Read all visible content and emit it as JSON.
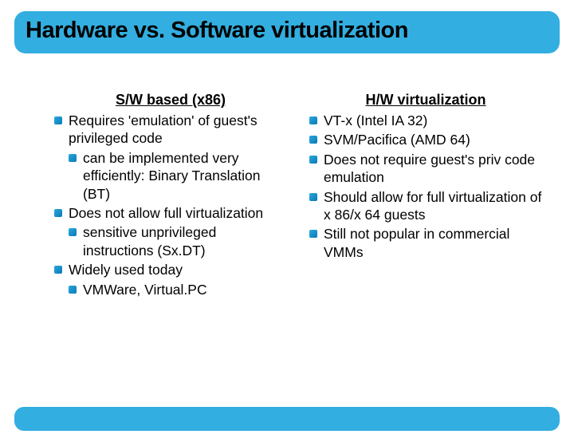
{
  "title": "Hardware vs. Software virtualization",
  "left": {
    "heading": "S/W based (x86)",
    "items": [
      {
        "text": "Requires 'emulation' of guest's privileged code",
        "sub": [
          {
            "text": "can be implemented very efficiently: Binary Translation (BT)"
          }
        ]
      },
      {
        "text": "Does not allow full virtualization",
        "sub": [
          {
            "text": "sensitive unprivileged instructions (Sx.DT)"
          }
        ]
      },
      {
        "text": "Widely used today",
        "sub": [
          {
            "text": "VMWare, Virtual.PC"
          }
        ]
      }
    ]
  },
  "right": {
    "heading": "H/W virtualization",
    "items": [
      {
        "text": "VT-x (Intel IA 32)"
      },
      {
        "text": "SVM/Pacifica (AMD 64)"
      },
      {
        "text": "Does not require guest's priv code emulation"
      },
      {
        "text": "Should allow for full virtualization of x 86/x 64 guests"
      },
      {
        "text": "Still not popular in commercial VMMs"
      }
    ]
  }
}
